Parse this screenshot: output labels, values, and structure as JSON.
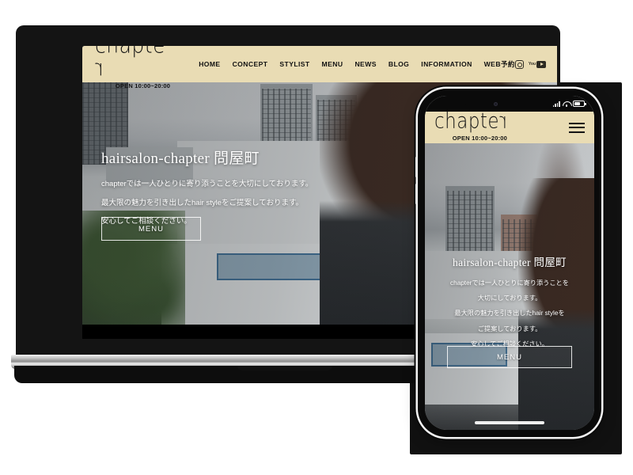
{
  "site": {
    "brand": {
      "logo_text": "chapte",
      "logo_last": "r",
      "hours": "OPEN 10:00~20:00"
    },
    "nav": [
      {
        "label": "HOME"
      },
      {
        "label": "CONCEPT"
      },
      {
        "label": "STYLIST"
      },
      {
        "label": "MENU"
      },
      {
        "label": "NEWS"
      },
      {
        "label": "BLOG"
      },
      {
        "label": "INFORMATION"
      },
      {
        "label": "WEB予約"
      }
    ],
    "socials": [
      {
        "name": "instagram-icon"
      },
      {
        "name": "youtube-icon",
        "label": "You"
      }
    ],
    "hero": {
      "title": "hairsalon-chapter 問屋町",
      "lines": [
        "chapterでは一人ひとりに寄り添うことを大切にしております。",
        "最大限の魅力を引き出したhair styleをご提案しております。",
        "安心してご相談ください。"
      ],
      "cta_label": "MENU"
    }
  },
  "phone": {
    "status": {
      "signal": "signal-icon",
      "wifi": "wifi-icon",
      "battery": "battery-icon"
    },
    "menu_toggle": "hamburger-icon",
    "hero": {
      "title": "hairsalon-chapter 問屋町",
      "lines": [
        "chapterでは一人ひとりに寄り添うことを",
        "大切にしております。",
        "最大限の魅力を引き出したhair styleを",
        "ご提案しております。",
        "安心してご相談ください。"
      ],
      "cta_label": "MENU"
    }
  },
  "colors": {
    "header_cream": "#e9dcb4",
    "device_black": "#0a0a0a",
    "text_dark": "#111111",
    "hero_text": "#ffffff"
  }
}
